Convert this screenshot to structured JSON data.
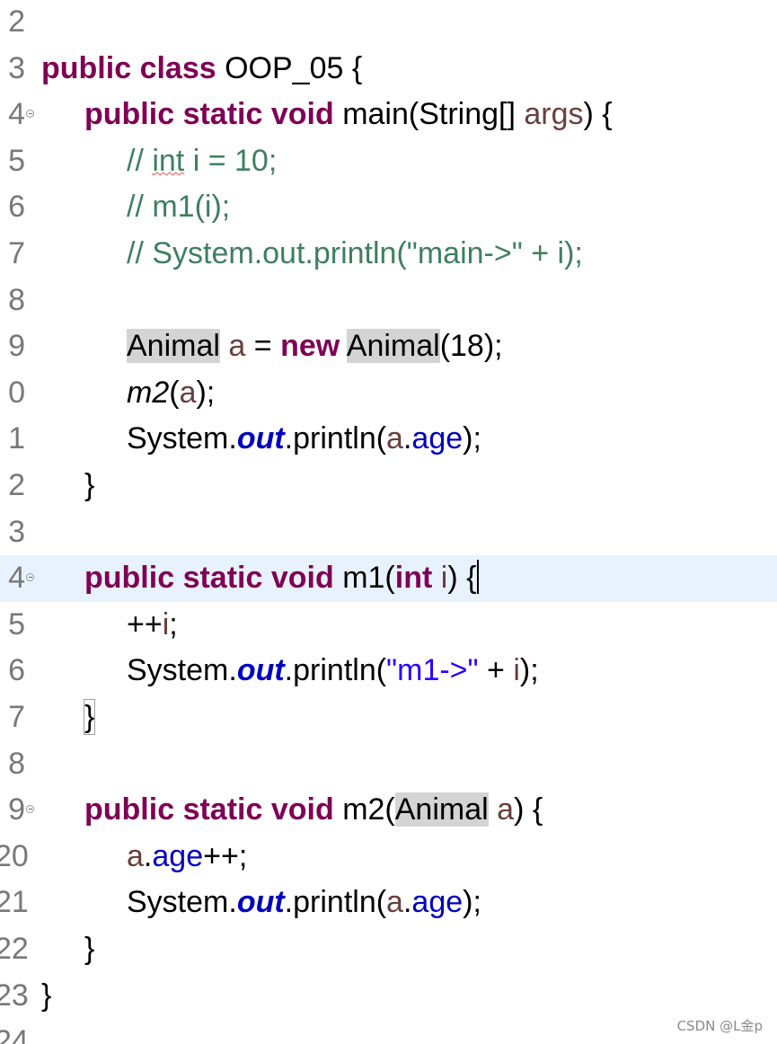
{
  "lines": [
    {
      "num": "2"
    },
    {
      "num": "3",
      "parts": [
        "public",
        "class",
        " OOP_05 {"
      ]
    },
    {
      "num": "4",
      "parts": [
        "public",
        "static",
        "void",
        " main(String[] ",
        "args",
        ") {"
      ]
    },
    {
      "num": "5",
      "parts": [
        "// ",
        "int",
        " i = 10;"
      ]
    },
    {
      "num": "6",
      "parts": [
        "// m1(i);"
      ]
    },
    {
      "num": "7",
      "parts": [
        "// System.out.println(\"main->\" + i);"
      ]
    },
    {
      "num": "8"
    },
    {
      "num": "9",
      "parts": [
        "Animal",
        " ",
        "a",
        " = ",
        "new",
        " ",
        "Animal",
        "(18);"
      ]
    },
    {
      "num": "0",
      "parts": [
        "m2",
        "(",
        "a",
        ");"
      ]
    },
    {
      "num": "1",
      "parts": [
        "System.",
        "out",
        ".println(",
        "a",
        ".",
        "age",
        ");"
      ]
    },
    {
      "num": "2",
      "parts": [
        "}"
      ]
    },
    {
      "num": "3"
    },
    {
      "num": "4",
      "parts": [
        "public",
        "static",
        "void",
        " m1(",
        "int",
        " ",
        "i",
        ") {"
      ]
    },
    {
      "num": "5",
      "parts": [
        "++",
        "i",
        ";"
      ]
    },
    {
      "num": "6",
      "parts": [
        "System.",
        "out",
        ".println(",
        "\"m1->\"",
        " + ",
        "i",
        ");"
      ]
    },
    {
      "num": "7",
      "parts": [
        "}"
      ]
    },
    {
      "num": "8"
    },
    {
      "num": "9",
      "parts": [
        "public",
        "static",
        "void",
        " m2(",
        "Animal",
        " ",
        "a",
        ") {"
      ]
    },
    {
      "num": "20",
      "parts": [
        "a",
        ".",
        "age",
        "++;"
      ]
    },
    {
      "num": "21",
      "parts": [
        "System.",
        "out",
        ".println(",
        "a",
        ".",
        "age",
        ");"
      ]
    },
    {
      "num": "22",
      "parts": [
        "}"
      ]
    },
    {
      "num": "23",
      "parts": [
        "}"
      ]
    },
    {
      "num": "24"
    }
  ],
  "watermark": "CSDN @L金p",
  "colors": {
    "keyword": "#7f0055",
    "comment": "#3f7f5f",
    "string": "#2a00ff",
    "field": "#0000c0",
    "local_variable": "#6a3e3e",
    "current_line": "#e8f2fe",
    "occurrence_highlight": "#d4d4d4"
  }
}
